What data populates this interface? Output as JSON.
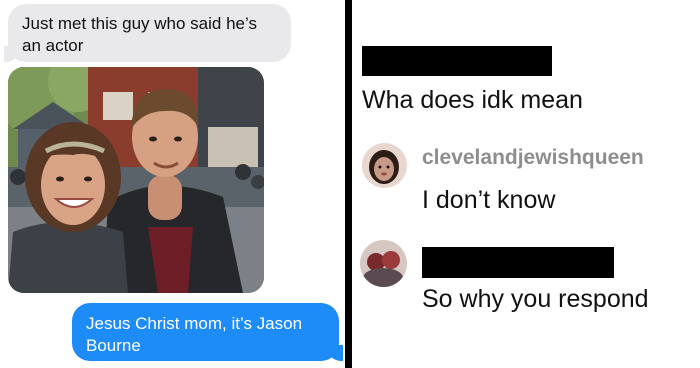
{
  "messages": {
    "incoming_text": "Just met this guy who said he’s an actor",
    "outgoing_text": "Jesus Christ mom, it’s Jason Bourne"
  },
  "thread": {
    "post_text": "Wha does idk mean",
    "reply_username": "clevelandjewishqueen",
    "reply_text": "I don’t know",
    "followup_text": "So why you respond"
  },
  "colors": {
    "incoming_bubble": "#e9e9eb",
    "outgoing_bubble": "#1d8cf8",
    "username_gray": "#8e8e8e",
    "redaction": "#000000"
  }
}
